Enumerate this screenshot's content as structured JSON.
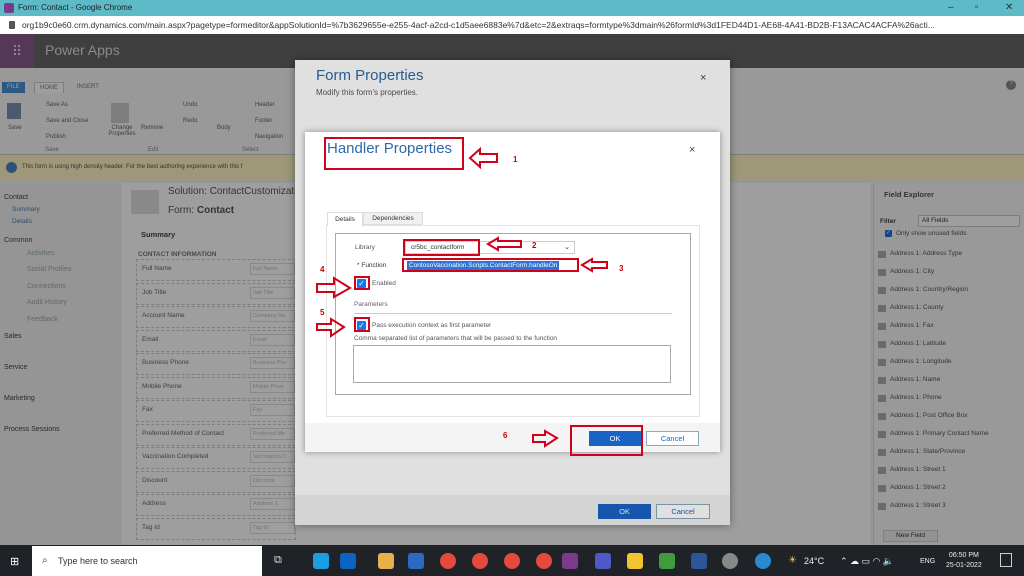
{
  "browser": {
    "title": "Form: Contact - Google Chrome",
    "url": "org1b9c0e60.crm.dynamics.com/main.aspx?pagetype=formeditor&appSolutionId=%7b3629655e-e255-4acf-a2cd-c1d5aee6883e%7d&etc=2&extraqs=formtype%3dmain%26formId%3d1FED44D1-AE68-4A41-BD2B-F13ACAC4ACFA%26acti..."
  },
  "app": {
    "name": "Power Apps"
  },
  "ribbon": {
    "tabs": [
      "FILE",
      "HOME",
      "INSERT"
    ],
    "save": "Save",
    "save_as": "Save As",
    "save_close": "Save and Close",
    "publish": "Publish",
    "change_props": "Change Properties",
    "remove": "Remove",
    "undo": "Undo",
    "redo": "Redo",
    "body": "Body",
    "header": "Header",
    "footer": "Footer",
    "navigation": "Navigation",
    "groups": [
      "Save",
      "Edit",
      "Select"
    ]
  },
  "info_bar": "This form is using high density header. For the best authoring experience with this f",
  "left_nav": {
    "contact": "Contact",
    "summary": "Summary",
    "details": "Details",
    "common": "Common",
    "links": [
      "Activities",
      "Social Profiles",
      "Connections",
      "Audit History",
      "Feedback"
    ],
    "sales": "Sales",
    "service": "Service",
    "marketing": "Marketing",
    "process": "Process Sessions"
  },
  "form": {
    "solution": "Solution: ContactCustomizatio",
    "form_label": "Form:",
    "form_name": "Contact",
    "section": "Summary",
    "subsection": "CONTACT INFORMATION",
    "fields": [
      {
        "label": "Full Name",
        "ph": "Full Name"
      },
      {
        "label": "Job Title",
        "ph": "Job Title"
      },
      {
        "label": "Account Name",
        "ph": "Company Na"
      },
      {
        "label": "Email",
        "ph": "Email"
      },
      {
        "label": "Business Phone",
        "ph": "Business Pho"
      },
      {
        "label": "Mobile Phone",
        "ph": "Mobile Phon"
      },
      {
        "label": "Fax",
        "ph": "Fax"
      },
      {
        "label": "Preferred Method of Contact",
        "ph": "Preferred Me"
      },
      {
        "label": "Vaccination Completed",
        "ph": "Vaccination C"
      },
      {
        "label": "Discount",
        "ph": "Discount"
      },
      {
        "label": "Address",
        "ph": "Address 1"
      },
      {
        "label": "Tag Id",
        "ph": "Tag Id"
      }
    ]
  },
  "field_explorer": {
    "title": "Field Explorer",
    "filter_label": "Filter",
    "filter_value": "All Fields",
    "only_unused": "Only show unused fields",
    "new_field": "New Field",
    "items": [
      "Address 1: Address Type",
      "Address 1: City",
      "Address 1: Country/Region",
      "Address 1: County",
      "Address 1: Fax",
      "Address 1: Latitude",
      "Address 1: Longitude",
      "Address 1: Name",
      "Address 1: Phone",
      "Address 1: Post Office Box",
      "Address 1: Primary Contact Name",
      "Address 1: State/Province",
      "Address 1: Street 1",
      "Address 1: Street 2",
      "Address 1: Street 3"
    ]
  },
  "form_properties": {
    "title": "Form Properties",
    "subtitle": "Modify this form's properties.",
    "ok": "OK",
    "cancel": "Cancel",
    "close": "×"
  },
  "handler": {
    "title": "Handler Properties",
    "close": "×",
    "tabs": [
      "Details",
      "Dependencies"
    ],
    "library_label": "Library",
    "library_value": "cr5bc_contactform",
    "function_label": "Function",
    "required": "*",
    "function_value": "ContosoVaccination.Scripts.ContactForm.handleOn",
    "enabled_label": "Enabled",
    "enabled": true,
    "parameters_heading": "Parameters",
    "pass_context_label": "Pass execution context as first parameter",
    "pass_context": true,
    "params_label": "Comma separated list of parameters that will be passed to the function",
    "params_value": "",
    "ok": "OK",
    "cancel": "Cancel"
  },
  "annotations": [
    "1",
    "2",
    "3",
    "4",
    "5",
    "6"
  ],
  "taskbar": {
    "search_placeholder": "Type here to search",
    "weather": "24°C",
    "lang": "ENG",
    "time": "06:50 PM",
    "date": "25-01-2022"
  },
  "colors": {
    "accent": "#1a62c4",
    "annotation": "#d0021b"
  }
}
